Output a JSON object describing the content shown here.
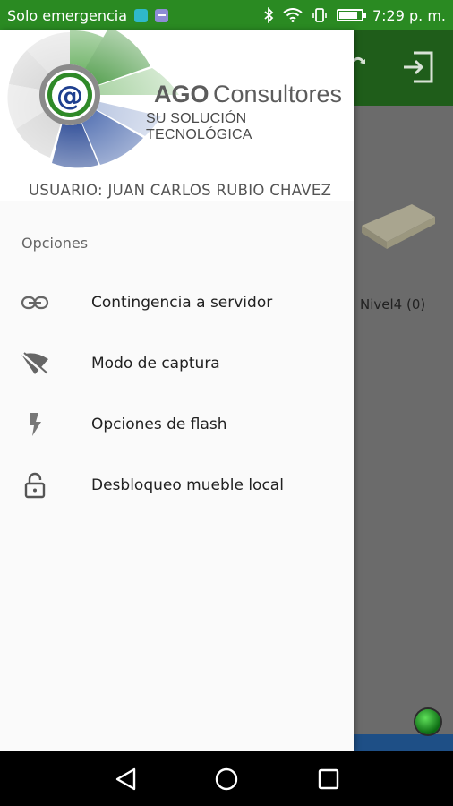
{
  "status_bar": {
    "carrier_text": "Solo emergencia",
    "time": "7:29 p. m.",
    "background_color": "#2a8a22",
    "icons": [
      "sim-icon",
      "notification-icon",
      "bluetooth-icon",
      "wifi-icon",
      "vibrate-icon",
      "battery-icon"
    ],
    "battery_level": 0.85
  },
  "background_app": {
    "toolbar_color": "#1f5d1a",
    "item_label": "Nivel4 (0)",
    "icons": [
      "sync-icon",
      "exit-icon",
      "status-dot-icon"
    ]
  },
  "drawer": {
    "header": {
      "brand_ago": "AGO",
      "brand_name": "Consultores",
      "tagline": "SU SOLUCIÓN TECNOLÓGICA",
      "user_line": "USUARIO: JUAN CARLOS RUBIO CHAVEZ"
    },
    "section_title": "Opciones",
    "items": [
      {
        "label": "Contingencia a servidor",
        "icon": "link-icon"
      },
      {
        "label": "Modo de captura",
        "icon": "signal-off-icon"
      },
      {
        "label": "Opciones de flash",
        "icon": "flash-icon"
      },
      {
        "label": "Desbloqueo mueble local",
        "icon": "lock-open-icon"
      }
    ]
  },
  "nav_bar": {
    "buttons": [
      "back-icon",
      "home-icon",
      "recents-icon"
    ]
  },
  "colors": {
    "brand_green": "#2e8b2a",
    "brand_blue": "#1f3f8f",
    "drawer_bg": "#fafafa"
  }
}
